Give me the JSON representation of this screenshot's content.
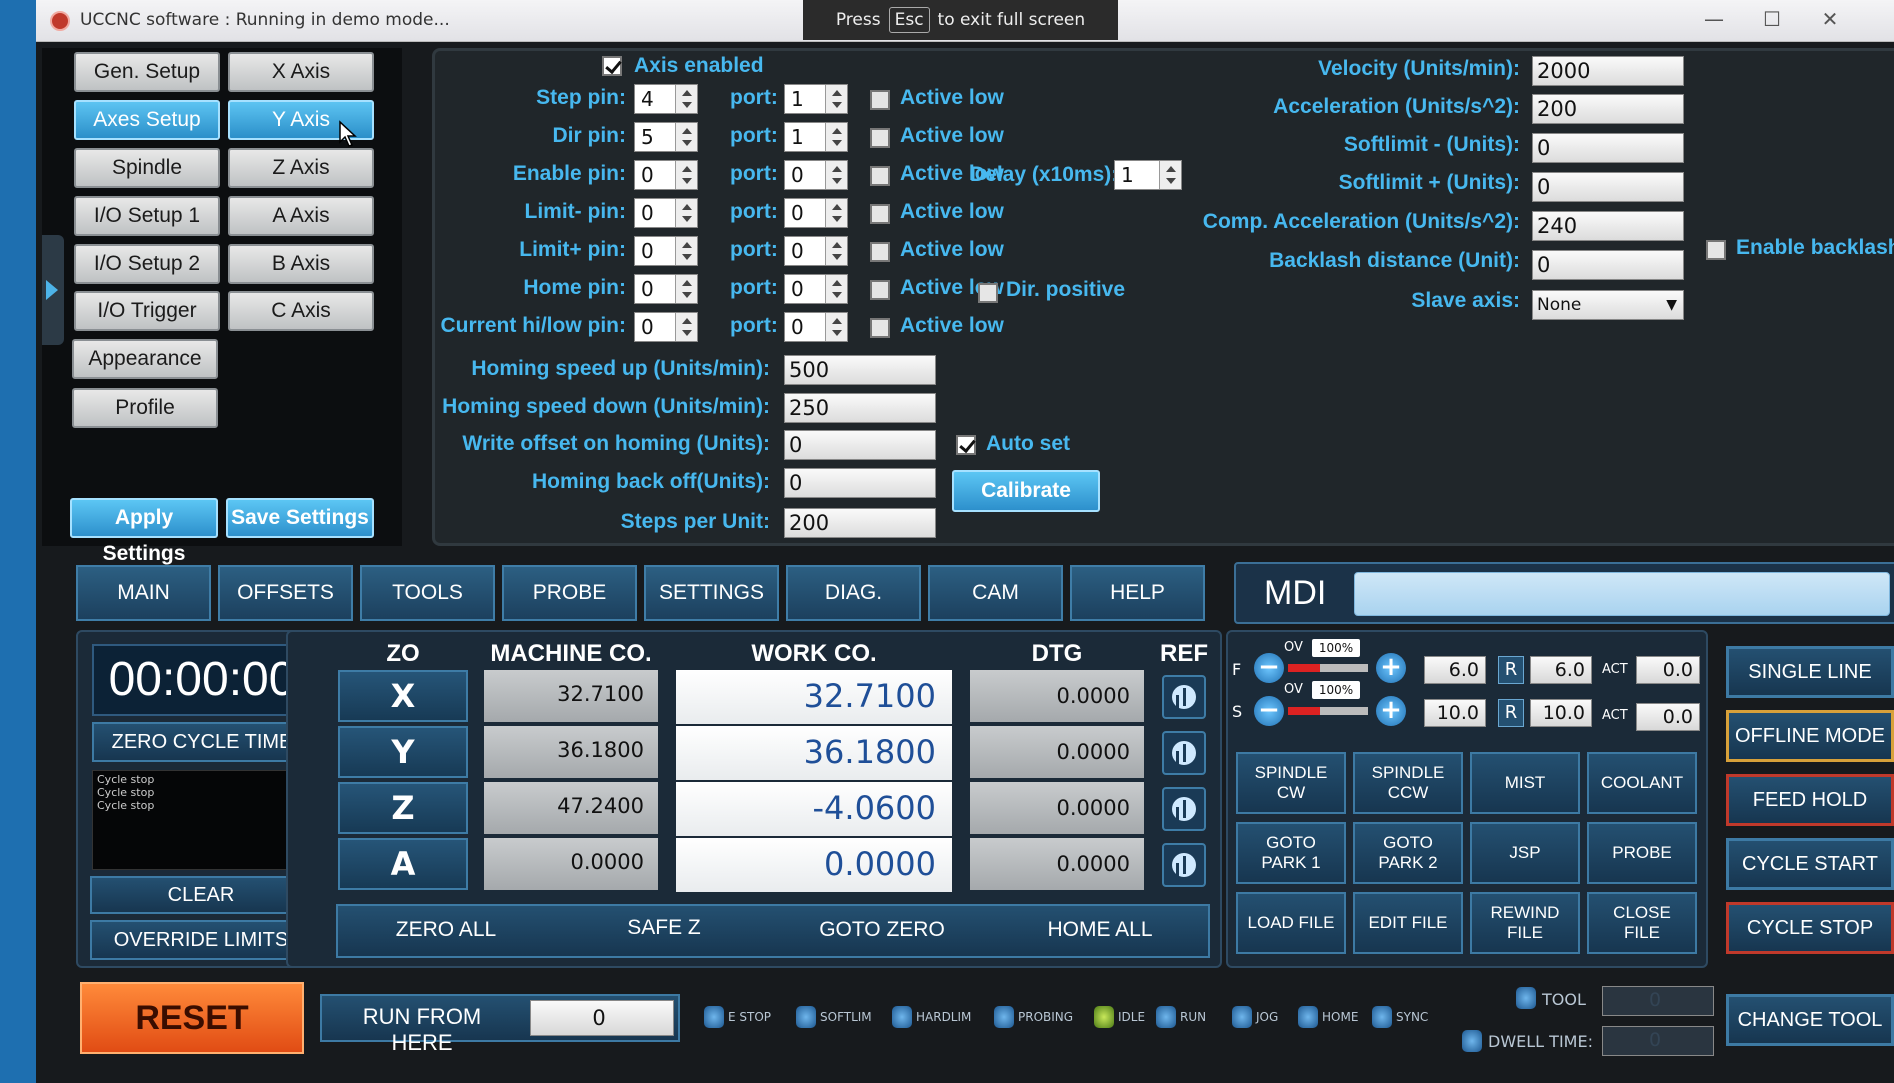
{
  "window": {
    "title": "UCCNC software : Running in demo mode...",
    "fullscreen_hint": {
      "pre": "Press",
      "key": "Esc",
      "post": "to exit full screen"
    },
    "controls": {
      "minimize": "—",
      "maximize": "☐",
      "close": "✕"
    }
  },
  "nav": {
    "left_col": [
      "Gen. Setup",
      "Axes Setup",
      "Spindle",
      "I/O Setup 1",
      "I/O Setup 2",
      "I/O Trigger",
      "Appearance",
      "Profile"
    ],
    "right_col": [
      "X Axis",
      "Y Axis",
      "Z Axis",
      "A Axis",
      "B Axis",
      "C Axis"
    ],
    "active_left": "Axes Setup",
    "active_right": "Y Axis",
    "apply": "Apply Settings",
    "save": "Save Settings"
  },
  "axis": {
    "axis_enabled": "Axis enabled",
    "port_label": "port:",
    "active_low": "Active low",
    "rows": [
      {
        "label": "Step pin:",
        "pin": "4",
        "port": "1"
      },
      {
        "label": "Dir pin:",
        "pin": "5",
        "port": "1"
      },
      {
        "label": "Enable pin:",
        "pin": "0",
        "port": "0"
      },
      {
        "label": "Limit- pin:",
        "pin": "0",
        "port": "0"
      },
      {
        "label": "Limit+ pin:",
        "pin": "0",
        "port": "0"
      },
      {
        "label": "Home pin:",
        "pin": "0",
        "port": "0"
      },
      {
        "label": "Current hi/low pin:",
        "pin": "0",
        "port": "0"
      }
    ],
    "delay_label": "Delay (x10ms):",
    "delay_value": "1",
    "dir_positive": "Dir. positive",
    "homing_up_label": "Homing speed up (Units/min):",
    "homing_up": "500",
    "homing_down_label": "Homing speed down (Units/min):",
    "homing_down": "250",
    "write_offset_label": "Write offset on homing (Units):",
    "write_offset": "0",
    "auto_set": "Auto set",
    "backoff_label": "Homing back off(Units):",
    "backoff": "0",
    "steps_label": "Steps per Unit:",
    "steps": "200",
    "calibrate": "Calibrate",
    "velocity_label": "Velocity (Units/min):",
    "velocity": "2000",
    "accel_label": "Acceleration (Units/s^2):",
    "accel": "200",
    "softminus_label": "Softlimit - (Units):",
    "softminus": "0",
    "softplus_label": "Softlimit + (Units):",
    "softplus": "0",
    "compacc_label": "Comp. Acceleration (Units/s^2):",
    "compacc": "240",
    "backlash_label": "Backlash distance (Unit):",
    "backlash": "0",
    "enable_backlash": "Enable backlash",
    "slave_label": "Slave axis:",
    "slave": "None"
  },
  "tabs": [
    "MAIN",
    "OFFSETS",
    "TOOLS",
    "PROBE",
    "SETTINGS",
    "DIAG.",
    "CAM",
    "HELP"
  ],
  "mdi": {
    "label": "MDI"
  },
  "cycle": {
    "time": "00:00:00",
    "zero_cycle": "ZERO CYCLE TIME",
    "log": [
      "Cycle stop",
      "Cycle stop",
      "Cycle stop"
    ],
    "clear": "CLEAR",
    "override": "OVERRIDE LIMITS"
  },
  "coords": {
    "headers": {
      "zo": "ZO",
      "machine": "MACHINE CO.",
      "work": "WORK CO.",
      "dtg": "DTG",
      "ref": "REF"
    },
    "axes": [
      {
        "name": "X",
        "machine": "32.7100",
        "work": "32.7100",
        "dtg": "0.0000"
      },
      {
        "name": "Y",
        "machine": "36.1800",
        "work": "36.1800",
        "dtg": "0.0000"
      },
      {
        "name": "Z",
        "machine": "47.2400",
        "work": "-4.0600",
        "dtg": "0.0000"
      },
      {
        "name": "A",
        "machine": "0.0000",
        "work": "0.0000",
        "dtg": "0.0000"
      }
    ],
    "zero_all": "ZERO ALL",
    "safe_z": "SAFE Z",
    "goto_zero": "GOTO ZERO",
    "home_all": "HOME ALL"
  },
  "overrides": {
    "f_label": "F",
    "s_label": "S",
    "ov": "OV",
    "r": "R",
    "act": "ACT",
    "f_pct": "100%",
    "f_val": "6.0",
    "f_r": "6.0",
    "f_act": "0.0",
    "s_pct": "100%",
    "s_val": "10.0",
    "s_r": "10.0",
    "s_act": "0.0"
  },
  "grid": [
    "SPINDLE\nCW",
    "SPINDLE\nCCW",
    "MIST",
    "COOLANT",
    "GOTO\nPARK 1",
    "GOTO\nPARK 2",
    "JSP",
    "PROBE",
    "LOAD FILE",
    "EDIT FILE",
    "REWIND\nFILE",
    "CLOSE\nFILE"
  ],
  "right_buttons": [
    "SINGLE LINE",
    "OFFLINE MODE",
    "FEED HOLD",
    "CYCLE START",
    "CYCLE STOP"
  ],
  "bottom": {
    "reset": "RESET",
    "run_from_here": "RUN FROM HERE",
    "run_value": "0",
    "leds": [
      "E STOP",
      "SOFTLIM",
      "HARDLIM",
      "PROBING",
      "IDLE",
      "RUN",
      "JOG",
      "HOME",
      "SYNC"
    ],
    "tool_label": "TOOL",
    "tool_value": "0",
    "dwell_label": "DWELL TIME:",
    "dwell_value": "0",
    "change_tool": "CHANGE TOOL"
  }
}
